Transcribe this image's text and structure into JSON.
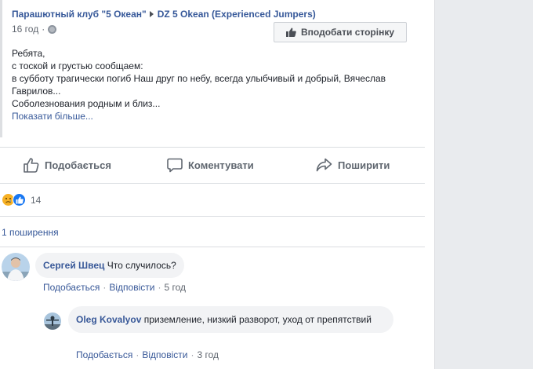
{
  "post": {
    "page_name": "Парашютный клуб \"5 Океан\"",
    "target_page": "DZ 5 Okean (Experienced Jumpers)",
    "time": "16 год",
    "separator": "·",
    "like_page_label": "Вподобати сторінку",
    "text_lines": [
      "Ребята,",
      "с тоской и грустью сообщаем:",
      "в субботу трагически погиб Наш друг по небу, всегда улыбчивый и добрый, Вячеслав Гаврилов...",
      "Соболезнования родным и близ..."
    ],
    "see_more": "Показати більше..."
  },
  "actions": {
    "like": "Подобається",
    "comment": "Коментувати",
    "share": "Поширити"
  },
  "reactions": {
    "count": "14",
    "icons": [
      "sad-reaction-icon",
      "like-reaction-icon"
    ]
  },
  "shares": "1 поширення",
  "comments": [
    {
      "author": "Сергей Швец",
      "text": "Что случилось?",
      "like": "Подобається",
      "reply": "Відповісти",
      "time": "5 год"
    },
    {
      "author": "Oleg Kovalyov",
      "text": "приземление, низкий разворот, уход от препятствий",
      "like": "Подобається",
      "reply": "Відповісти",
      "time": "3 год"
    }
  ],
  "colors": {
    "link": "#365899",
    "background": "#e9ebee",
    "like_blue": "#1877f2",
    "sad_yellow": "#f7b125"
  }
}
